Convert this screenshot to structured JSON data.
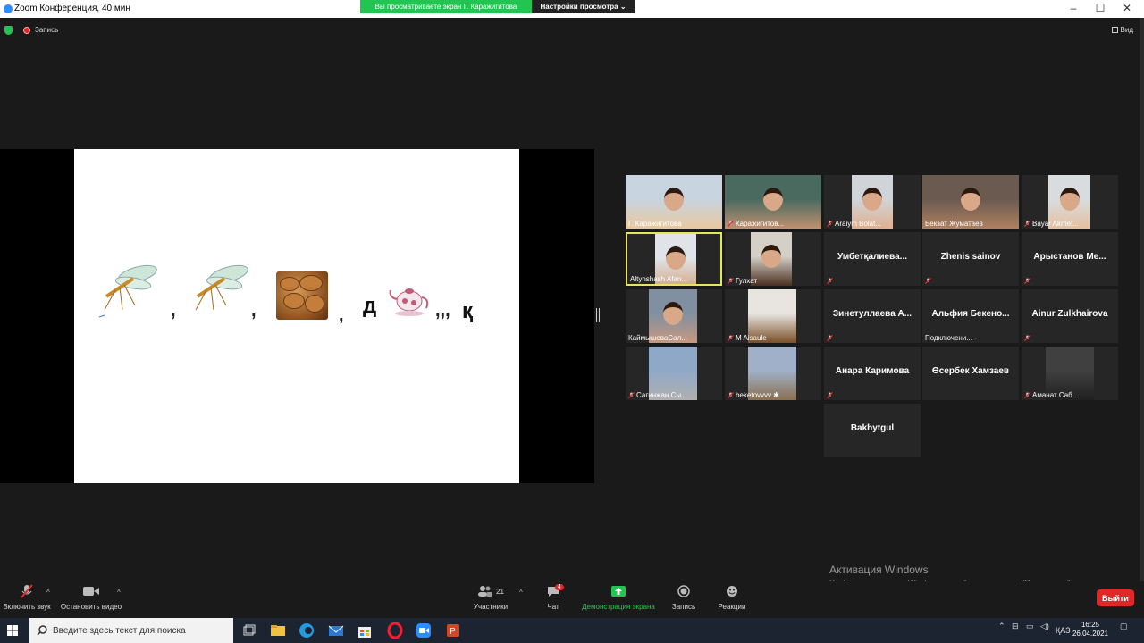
{
  "window": {
    "title": "Zoom Конференция, 40 мин",
    "banner": "Вы просматриваете экран Г. Каражигитова",
    "view_options": "Настройки просмотра ⌄"
  },
  "topbar": {
    "recording": "Запись",
    "view": "Вид"
  },
  "slide": {
    "commas": [
      ",",
      ",",
      ",",
      ",,,"
    ],
    "letters": [
      "д",
      "қ"
    ]
  },
  "participants": [
    {
      "name": "Г. Каражигитова",
      "kind": "video",
      "muted": false
    },
    {
      "name": "Каражигитов...",
      "kind": "video",
      "muted": true
    },
    {
      "name": "Araiym Bolat...",
      "kind": "video",
      "muted": true
    },
    {
      "name": "Бекзат Жуматаев",
      "kind": "video",
      "muted": false
    },
    {
      "name": "Bayar Akmet...",
      "kind": "video",
      "muted": true
    },
    {
      "name": "Altynshash Afan...",
      "kind": "video",
      "muted": false,
      "active": true
    },
    {
      "name": "Гулхат",
      "kind": "video",
      "muted": true
    },
    {
      "name": "Умбетқалиева...",
      "kind": "name",
      "muted": true
    },
    {
      "name": "Zhenis sainov",
      "kind": "name",
      "muted": true
    },
    {
      "name": "Арыстанов  Ме...",
      "kind": "name",
      "muted": true
    },
    {
      "name": "КаймышеваСал...",
      "kind": "video",
      "muted": false
    },
    {
      "name": "M Aisaule",
      "kind": "video",
      "muted": true
    },
    {
      "name": "Зинетуллаева  А...",
      "kind": "name",
      "muted": true
    },
    {
      "name": "Альфия  Бекено...",
      "kind": "name",
      "muted": false,
      "sub": "Подключени... -·"
    },
    {
      "name": "Ainur Zulkhairova",
      "kind": "name",
      "muted": true
    },
    {
      "name": "Сагинжан Сы...",
      "kind": "video",
      "muted": true
    },
    {
      "name": "beketovvvv ✱",
      "kind": "video",
      "muted": true
    },
    {
      "name": "Анара Каримова",
      "kind": "name",
      "muted": true
    },
    {
      "name": "Өсербек Хамзаев",
      "kind": "name",
      "muted": false
    },
    {
      "name": "Аманат Саб...",
      "kind": "video",
      "muted": true
    },
    {
      "name": "Bakhytgul",
      "kind": "name",
      "muted": false
    }
  ],
  "toolbar": {
    "unmute": "Включить звук",
    "stop_video": "Остановить видео",
    "participants": "Участники",
    "participants_count": "21",
    "chat": "Чат",
    "chat_badge": "4",
    "share": "Демонстрация экрана",
    "record": "Запись",
    "reactions": "Реакции",
    "leave": "Выйти"
  },
  "activation": {
    "title": "Активация Windows",
    "text": "Чтобы активировать Windows, перейдите в раздел \"Параметры\"."
  },
  "taskbar": {
    "search_placeholder": "Введите здесь текст для поиска",
    "lang": "ҚАЗ",
    "time": "16:25",
    "date": "26.04.2021"
  }
}
